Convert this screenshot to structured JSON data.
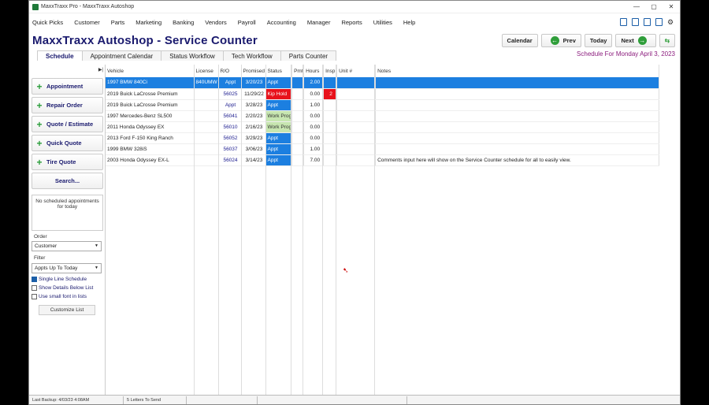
{
  "window": {
    "title": "MaxxTraxx Pro - MaxxTraxx Autoshop",
    "min": "—",
    "max": "▢",
    "close": "✕"
  },
  "menu": [
    "Quick Picks",
    "Customer",
    "Parts",
    "Marketing",
    "Banking",
    "Vendors",
    "Payroll",
    "Accounting",
    "Manager",
    "Reports",
    "Utilities",
    "Help"
  ],
  "header": {
    "title": "MaxxTraxx Autoshop - Service Counter",
    "calendar": "Calendar",
    "prev": "Prev",
    "today": "Today",
    "next": "Next"
  },
  "tabs": [
    "Schedule",
    "Appointment Calendar",
    "Status Workflow",
    "Tech Workflow",
    "Parts Counter"
  ],
  "schedule_for": "Schedule For Monday April  3, 2023",
  "sidebar": {
    "appointment": "Appointment",
    "repair_order": "Repair Order",
    "quote_estimate": "Quote / Estimate",
    "quick_quote": "Quick Quote",
    "tire_quote": "Tire Quote",
    "search": "Search...",
    "no_appts": "No scheduled appointments for today",
    "order_label": "Order",
    "order_value": "Customer",
    "filter_label": "Filter",
    "filter_value": "Appts Up To Today",
    "single_line": "Single Line Schedule",
    "show_details": "Show Details Below List",
    "small_font": "Use small font in lists",
    "customize": "Customize List"
  },
  "columns": [
    "Vehicle",
    "License",
    "R/O",
    "Promised",
    "Status",
    "Pmt",
    "Hours",
    "Insp",
    "Unit #",
    "Notes"
  ],
  "rows": [
    {
      "vehicle": "1997 BMW  840Ci",
      "license": "840UMW",
      "ro": "Appt",
      "promised": "3/20/23",
      "status": "Appt",
      "pmt": "",
      "hours": "2.00",
      "insp": "",
      "unit": "",
      "notes": ""
    },
    {
      "vehicle": "2019 Buick  LaCrosse Premium",
      "license": "",
      "ro": "56025",
      "promised": "11/29/22",
      "status": "Kip Hold",
      "pmt": "",
      "hours": "0.00",
      "insp": "2",
      "unit": "",
      "notes": ""
    },
    {
      "vehicle": "2019 Buick  LaCrosse Premium",
      "license": "",
      "ro": "Appt",
      "promised": "3/28/23",
      "status": "Appt",
      "pmt": "",
      "hours": "1.00",
      "insp": "",
      "unit": "",
      "notes": ""
    },
    {
      "vehicle": "1997 Mercedes-Benz  SL500",
      "license": "",
      "ro": "56041",
      "promised": "2/20/23",
      "status": "Work Prog",
      "pmt": "",
      "hours": "0.00",
      "insp": "",
      "unit": "",
      "notes": ""
    },
    {
      "vehicle": "2011 Honda  Odyssey EX",
      "license": "",
      "ro": "56010",
      "promised": "2/16/23",
      "status": "Work Prog",
      "pmt": "",
      "hours": "0.00",
      "insp": "",
      "unit": "",
      "notes": ""
    },
    {
      "vehicle": "2013 Ford  F-150 King Ranch",
      "license": "",
      "ro": "56052",
      "promised": "3/29/23",
      "status": "Appt",
      "pmt": "",
      "hours": "0.00",
      "insp": "",
      "unit": "",
      "notes": ""
    },
    {
      "vehicle": "1999 BMW  328iS",
      "license": "",
      "ro": "56037",
      "promised": "3/06/23",
      "status": "Appt",
      "pmt": "",
      "hours": "1.00",
      "insp": "",
      "unit": "",
      "notes": ""
    },
    {
      "vehicle": "2003 Honda  Odyssey EX-L",
      "license": "",
      "ro": "56024",
      "promised": "3/14/23",
      "status": "Appt",
      "pmt": "",
      "hours": "7.00",
      "insp": "",
      "unit": "",
      "notes": "Comments input here will show on the Service Counter schedule for all to easily view."
    }
  ],
  "statusbar": {
    "last_backup": "Last Backup: 4/03/23  4:08AM",
    "letters": "5 Letters To Send"
  }
}
